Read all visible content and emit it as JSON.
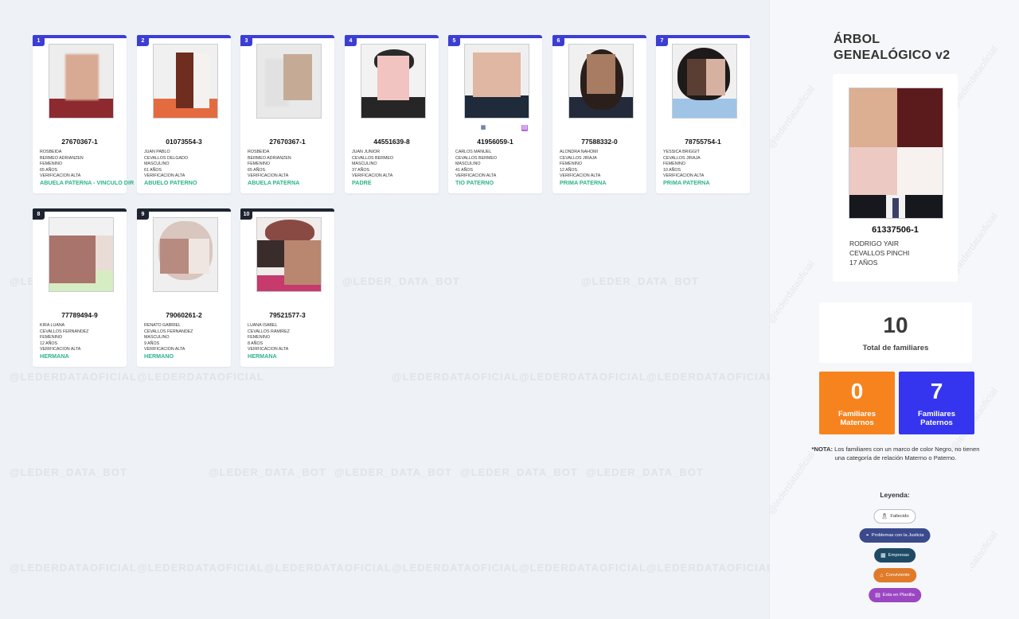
{
  "watermarks": {
    "official": "@LEDERDATAOFICIAL",
    "bot": "@LEDER_DATA_BOT",
    "side": "@lederdataoficial"
  },
  "colors": {
    "accent_bar": "#3c3ed3",
    "relation_green": "#2bb48a",
    "maternal_orange": "#f7831e",
    "paternal_blue": "#3535ef",
    "unrelated_bar": "#1e2330"
  },
  "relatives": [
    {
      "index": "1",
      "dni": "27670367-1",
      "lines": [
        "ROSBEIDA",
        "BERMEO ADRIANZEN",
        "FEMENINO",
        "65 AÑOS",
        "VERIFICACION ALTA"
      ],
      "relation": "ABUELA PATERNA - VINCULO DIR",
      "bar": "accent",
      "icons": []
    },
    {
      "index": "2",
      "dni": "01073554-3",
      "lines": [
        "JUAN PABLO",
        "CEVALLOS DELGADO",
        "MASCULINO",
        "61 AÑOS",
        "VERIFICACION ALTA"
      ],
      "relation": "ABUELO PATERNO",
      "bar": "accent",
      "icons": []
    },
    {
      "index": "3",
      "dni": "27670367-1",
      "lines": [
        "ROSBEIDA",
        "BERMEO ADRIANZEN",
        "FEMENINO",
        "65 AÑOS",
        "VERIFICACION ALTA"
      ],
      "relation": "ABUELA PATERNA",
      "bar": "accent",
      "icons": []
    },
    {
      "index": "4",
      "dni": "44551639-8",
      "lines": [
        "JUAN JUNIOR",
        "CEVALLOS BERMEO",
        "MASCULINO",
        "37 AÑOS",
        "VERIFICACION ALTA"
      ],
      "relation": "PADRE",
      "bar": "accent",
      "icons": []
    },
    {
      "index": "5",
      "dni": "41956059-1",
      "lines": [
        "CARLOS MANUEL",
        "CEVALLOS BERMEO",
        "MASCULINO",
        "41 AÑOS",
        "VERIFICACION ALTA"
      ],
      "relation": "TIO PATERNO",
      "bar": "accent",
      "icons": [
        "building-icon",
        "planilla-icon"
      ]
    },
    {
      "index": "6",
      "dni": "77588332-0",
      "lines": [
        "ALONDRA NAHOMI",
        "CEVALLOS JIRAJA",
        "FEMENINO",
        "12 AÑOS",
        "VERIFICACION ALTA"
      ],
      "relation": "PRIMA PATERNA",
      "bar": "accent",
      "icons": []
    },
    {
      "index": "7",
      "dni": "78755754-1",
      "lines": [
        "YESSICA BRIGGIT",
        "CEVALLOS JIRAJA",
        "FEMENINO",
        "10 AÑOS",
        "VERIFICACION ALTA"
      ],
      "relation": "PRIMA PATERNA",
      "bar": "accent",
      "icons": []
    },
    {
      "index": "8",
      "dni": "77789494-9",
      "lines": [
        "KIRA LUANA",
        "CEVALLOS FERNANDEZ",
        "FEMENINO",
        "12 AÑOS",
        "VERIFICACION ALTA"
      ],
      "relation": "HERMANA",
      "bar": "dark",
      "icons": []
    },
    {
      "index": "9",
      "dni": "79060261-2",
      "lines": [
        "RENATO GABRIEL",
        "CEVALLOS FERNANDEZ",
        "MASCULINO",
        "9 AÑOS",
        "VERIFICACION ALTA"
      ],
      "relation": "HERMANO",
      "bar": "dark",
      "icons": []
    },
    {
      "index": "10",
      "dni": "79521577-3",
      "lines": [
        "LUANA ISABEL",
        "CEVALLOS RAMIREZ",
        "FEMENINO",
        "8 AÑOS",
        "VERIFICACION ALTA"
      ],
      "relation": "HERMANA",
      "bar": "dark",
      "icons": []
    }
  ],
  "sidebar": {
    "title_line1": "ÁRBOL",
    "title_line2": "GENEALÓGICO v2",
    "main_person": {
      "dni": "61337506-1",
      "name1": "RODRIGO YAIR",
      "name2": "CEVALLOS PINCHI",
      "age": "17 AÑOS"
    },
    "total": {
      "value": "10",
      "label": "Total de familiares"
    },
    "maternal": {
      "value": "0",
      "label1": "Familiares",
      "label2": "Maternos"
    },
    "paternal": {
      "value": "7",
      "label1": "Familiares",
      "label2": "Paternos"
    },
    "note_bold": "*NOTA:",
    "note_text": " Los familiares con un marco de color Negro, no tienen una categoría de relación Materno o Paterno.",
    "legend": {
      "title": "Leyenda:",
      "items": [
        {
          "label": "Fallecido",
          "icon": "ribbon-icon"
        },
        {
          "label": "Problemas con la Justicia",
          "icon": "police-cap-icon"
        },
        {
          "label": "Empresas",
          "icon": "building-icon"
        },
        {
          "label": "Conviviente",
          "icon": "home-icon"
        },
        {
          "label": "Esta en Planilla",
          "icon": "payroll-icon"
        }
      ]
    }
  }
}
